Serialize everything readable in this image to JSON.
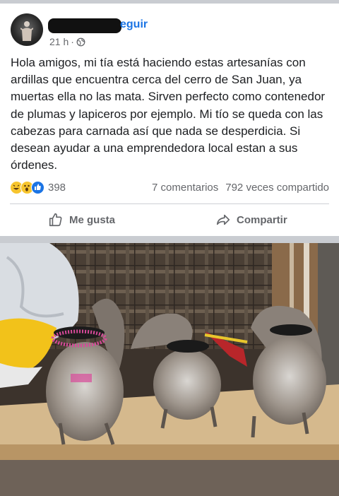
{
  "post": {
    "author_follow": "eguir",
    "time": "21 h",
    "separator": "·",
    "text": "Hola amigos, mi tía está haciendo estas artesanías con ardillas que encuentra cerca del cerro de San Juan, ya muertas ella no las mata. Sirven perfecto como contenedor de plumas y lapiceros por ejemplo. Mi tío se queda con las cabezas para carnada así que nada se desperdicia. Si desean ayudar a una emprendedora local estan a sus órdenes.",
    "reactions_count": "398",
    "comments": "7 comentarios",
    "shares": "792 veces compartido",
    "reaction_icons": [
      "haha-icon",
      "wow-icon",
      "like-icon"
    ]
  },
  "actions": {
    "like_label": "Me gusta",
    "share_label": "Compartir"
  },
  "colors": {
    "link_blue": "#1b74e4",
    "secondary_text": "#65676b",
    "divider": "#ced0d4"
  }
}
